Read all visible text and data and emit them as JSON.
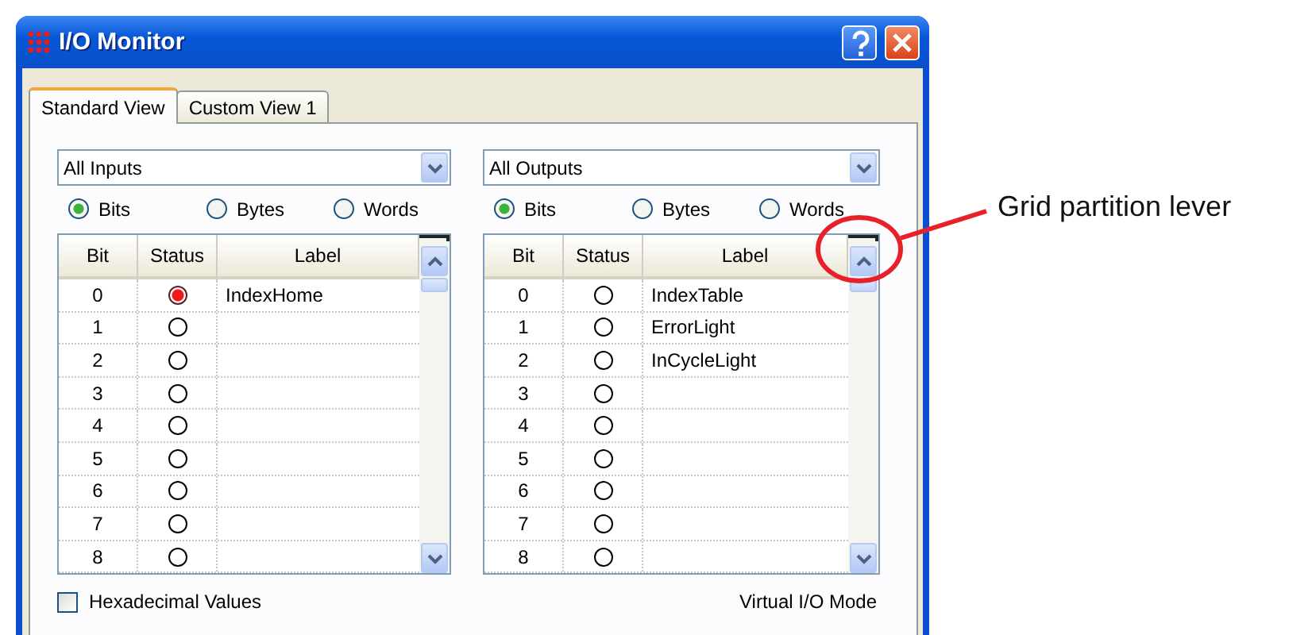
{
  "window": {
    "title": "I/O Monitor"
  },
  "tabs": [
    {
      "label": "Standard View",
      "selected": true
    },
    {
      "label": "Custom View 1",
      "selected": false
    }
  ],
  "panels": [
    {
      "dropdown": {
        "value": "All Inputs"
      },
      "radios": [
        {
          "label": "Bits",
          "selected": true
        },
        {
          "label": "Bytes",
          "selected": false
        },
        {
          "label": "Words",
          "selected": false
        }
      ],
      "table": {
        "columns": [
          "Bit",
          "Status",
          "Label"
        ],
        "rows": [
          {
            "bit": "0",
            "on": true,
            "label": "IndexHome"
          },
          {
            "bit": "1",
            "on": false
          },
          {
            "bit": "2",
            "on": false
          },
          {
            "bit": "3",
            "on": false
          },
          {
            "bit": "4",
            "on": false
          },
          {
            "bit": "5",
            "on": false
          },
          {
            "bit": "6",
            "on": false
          },
          {
            "bit": "7",
            "on": false
          },
          {
            "bit": "8",
            "on": false
          }
        ]
      }
    },
    {
      "dropdown": {
        "value": "All Outputs"
      },
      "radios": [
        {
          "label": "Bits",
          "selected": true
        },
        {
          "label": "Bytes",
          "selected": false
        },
        {
          "label": "Words",
          "selected": false
        }
      ],
      "table": {
        "columns": [
          "Bit",
          "Status",
          "Label"
        ],
        "rows": [
          {
            "bit": "0",
            "on": false,
            "label": "IndexTable"
          },
          {
            "bit": "1",
            "on": false,
            "label": "ErrorLight"
          },
          {
            "bit": "2",
            "on": false,
            "label": "InCycleLight"
          },
          {
            "bit": "3",
            "on": false
          },
          {
            "bit": "4",
            "on": false
          },
          {
            "bit": "5",
            "on": false
          },
          {
            "bit": "6",
            "on": false
          },
          {
            "bit": "7",
            "on": false
          },
          {
            "bit": "8",
            "on": false
          }
        ]
      }
    }
  ],
  "footer": {
    "checkbox": {
      "label": "Hexadecimal Values",
      "checked": false
    },
    "mode": "Virtual I/O Mode"
  },
  "annotation": {
    "text": "Grid partition lever"
  }
}
